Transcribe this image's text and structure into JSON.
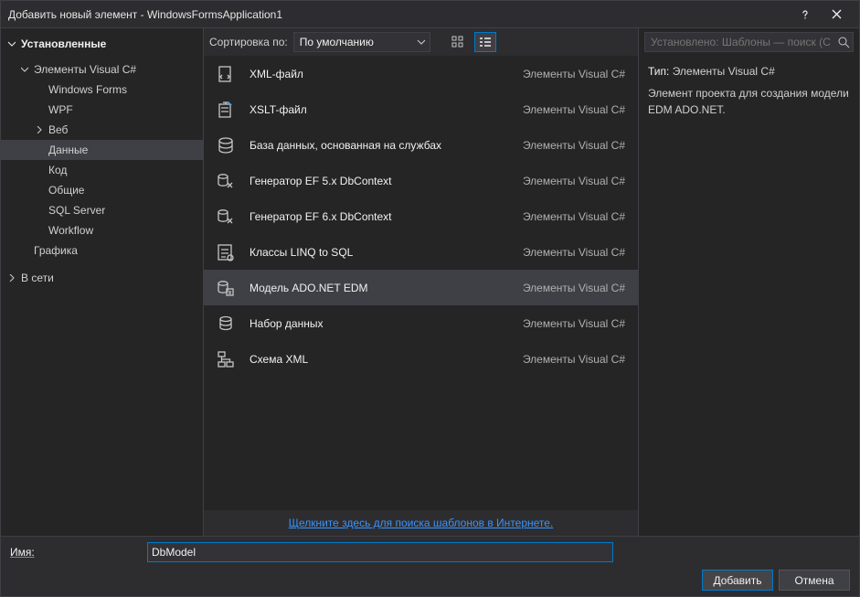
{
  "window": {
    "title": "Добавить новый элемент - WindowsFormsApplication1"
  },
  "tree": {
    "installed": "Установленные",
    "visual_csharp": "Элементы Visual C#",
    "windows_forms": "Windows Forms",
    "wpf": "WPF",
    "web": "Веб",
    "data": "Данные",
    "code": "Код",
    "general": "Общие",
    "sqlserver": "SQL Server",
    "workflow": "Workflow",
    "graphics": "Графика",
    "online": "В сети"
  },
  "toolbar": {
    "sort_label": "Сортировка по:",
    "sort_value": "По умолчанию"
  },
  "search": {
    "placeholder": "Установлено: Шаблоны — поиск (Ctrl+E)"
  },
  "templates": [
    {
      "name": "XML-файл",
      "category": "Элементы Visual C#",
      "icon": "xml"
    },
    {
      "name": "XSLT-файл",
      "category": "Элементы Visual C#",
      "icon": "xslt"
    },
    {
      "name": "База данных, основанная на службах",
      "category": "Элементы Visual C#",
      "icon": "db"
    },
    {
      "name": "Генератор EF 5.x DbContext",
      "category": "Элементы Visual C#",
      "icon": "ef"
    },
    {
      "name": "Генератор EF 6.x DbContext",
      "category": "Элементы Visual C#",
      "icon": "ef"
    },
    {
      "name": "Классы LINQ to SQL",
      "category": "Элементы Visual C#",
      "icon": "linq"
    },
    {
      "name": "Модель ADO.NET EDM",
      "category": "Элементы Visual C#",
      "icon": "edm",
      "selected": true
    },
    {
      "name": "Набор данных",
      "category": "Элементы Visual C#",
      "icon": "dataset"
    },
    {
      "name": "Схема XML",
      "category": "Элементы Visual C#",
      "icon": "xsd"
    }
  ],
  "desc": {
    "type_label": "Тип:",
    "type_value": "Элементы Visual C#",
    "text": "Элемент проекта для создания модели EDM ADO.NET."
  },
  "online_link": "Щелкните здесь для поиска шаблонов в Интернете.",
  "footer": {
    "name_label": "Имя:",
    "name_value": "DbModel",
    "add": "Добавить",
    "cancel": "Отмена"
  }
}
